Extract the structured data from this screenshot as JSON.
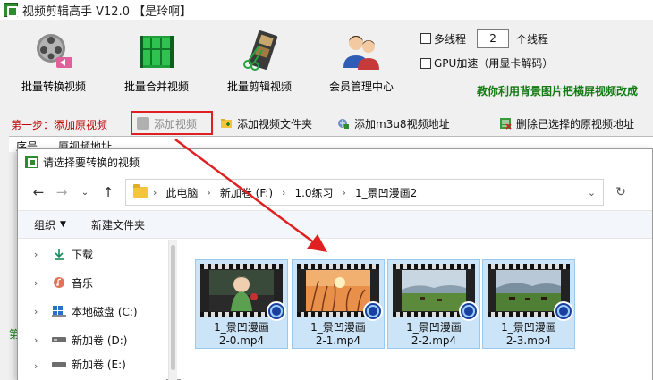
{
  "app": {
    "title": "视频剪辑高手 V12.0  【是玲啊】"
  },
  "toolbar": {
    "batch_convert": "批量转换视频",
    "batch_merge": "批量合并视频",
    "batch_edit": "批量剪辑视频",
    "member_center": "会员管理中心"
  },
  "options": {
    "multithread_label": "多线程",
    "thread_count": "2",
    "thread_unit": "个线程",
    "gpu_label": "GPU加速（用显卡解码）"
  },
  "tutorial": "教你利用背景图片把横屏视频改成",
  "step": {
    "label": "第一步：添加原视频",
    "add_video": "添加视频",
    "add_folder": "添加视频文件夹",
    "add_m3u8": "添加m3u8视频地址",
    "delete_selected": "删除已选择的原视频地址"
  },
  "table": {
    "col_index": "序号",
    "col_path": "原视频地址"
  },
  "left_edge_text": "第",
  "dialog": {
    "title": "请选择要转换的视频",
    "breadcrumb": [
      "此电脑",
      "新加卷 (F:)",
      "1.0练习",
      "1_景凹漫画2"
    ],
    "organize": "组织",
    "new_folder": "新建文件夹",
    "nav": [
      {
        "label": "下载",
        "icon": "download-icon"
      },
      {
        "label": "音乐",
        "icon": "music-icon"
      },
      {
        "label": "本地磁盘 (C:)",
        "icon": "windows-drive-icon"
      },
      {
        "label": "新加卷 (D:)",
        "icon": "drive-icon"
      },
      {
        "label": "新加卷 (E:)",
        "icon": "drive-icon"
      }
    ],
    "files": [
      {
        "line1": "1_景凹漫画",
        "line2": "2-0.mp4"
      },
      {
        "line1": "1_景凹漫画",
        "line2": "2-1.mp4"
      },
      {
        "line1": "1_景凹漫画",
        "line2": "2-2.mp4"
      },
      {
        "line1": "1_景凹漫画",
        "line2": "2-3.mp4"
      }
    ]
  },
  "colors": {
    "selection": "#cce4f7",
    "highlight_box": "#e02020",
    "step_text": "#c00000",
    "tutorial_text": "#117a11"
  }
}
